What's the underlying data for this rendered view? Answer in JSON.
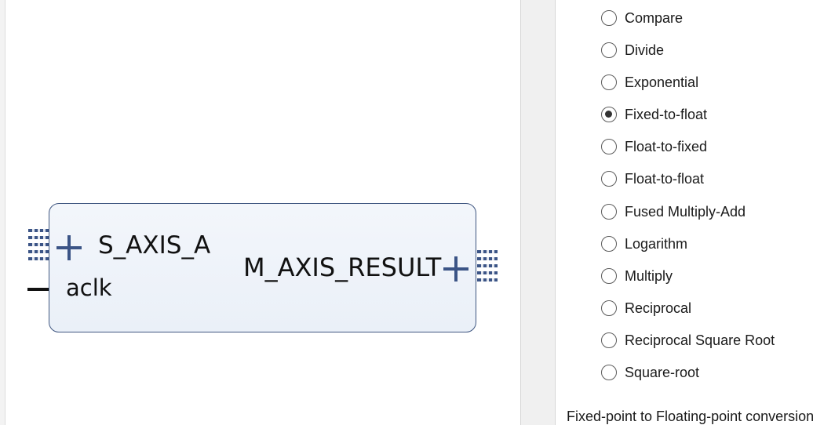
{
  "block": {
    "slave_port": "S_AXIS_A",
    "clock_port": "aclk",
    "master_port": "M_AXIS_RESULT"
  },
  "operations": {
    "options": [
      {
        "label": "Compare",
        "selected": false
      },
      {
        "label": "Divide",
        "selected": false
      },
      {
        "label": "Exponential",
        "selected": false
      },
      {
        "label": "Fixed-to-float",
        "selected": true
      },
      {
        "label": "Float-to-fixed",
        "selected": false
      },
      {
        "label": "Float-to-float",
        "selected": false
      },
      {
        "label": "Fused Multiply-Add",
        "selected": false
      },
      {
        "label": "Logarithm",
        "selected": false
      },
      {
        "label": "Multiply",
        "selected": false
      },
      {
        "label": "Reciprocal",
        "selected": false
      },
      {
        "label": "Reciprocal Square Root",
        "selected": false
      },
      {
        "label": "Square-root",
        "selected": false
      }
    ],
    "description": "Fixed-point to Floating-point conversion"
  },
  "colors": {
    "block_border": "#3f5680",
    "block_fill": "#eaf0f8",
    "port_icon": "#3b5486"
  },
  "icons": {
    "expand_port": "plus-icon",
    "bus_interface": "bus-interface-icon"
  }
}
